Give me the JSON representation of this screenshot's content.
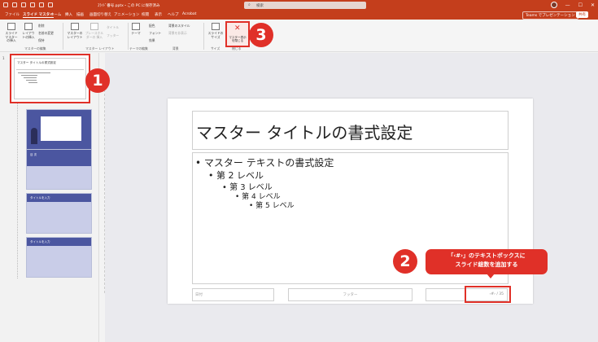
{
  "titlebar": {
    "file_name": "ｽﾗｲﾄﾞ番号.pptx・この PC に保存済み",
    "search_placeholder": "検索",
    "minimize": "—",
    "maximize": "☐",
    "close": "✕"
  },
  "tabs": [
    "ファイル",
    "スライド マスター",
    "ホーム",
    "挿入",
    "描画",
    "画面切り替え",
    "アニメーション",
    "校閲",
    "表示",
    "ヘルプ",
    "Acrobat"
  ],
  "tab_teams": "Teams でプレゼンテーション",
  "tab_share": "共有",
  "ribbon": {
    "insert_master": "スライド マスターの挿入",
    "insert_layout": "レイアウトの挿入",
    "delete": "削除",
    "rename": "名前の変更",
    "preserve": "保持",
    "master_layout": "マスターの レイアウト",
    "insert_placeholder": "プレースホルダーの 挿入",
    "title_chk": "タイトル",
    "footer_chk": "フッター",
    "theme": "テーマ",
    "colors": "配色",
    "fonts": "フォント",
    "effects": "効果",
    "bg_styles": "背景のスタイル",
    "hide_bg": "背景を非表示",
    "slide_size": "スライドの サイズ",
    "close_master": "マスター表示 を閉じる",
    "group_edit_master": "マスターの編集",
    "group_master_layout": "マスター レイアウト",
    "group_theme": "テーマの編集",
    "group_bg": "背景",
    "group_size": "サイズ",
    "group_close": "閉じる"
  },
  "thumbnails": {
    "slide_no": "1",
    "master_title": "マスター タイトルの書式設定",
    "layout3_label": "目 次",
    "layout4_label": "タイトルを入力",
    "layout5_label": "タイトルを入力"
  },
  "slide": {
    "title": "マスター タイトルの書式設定",
    "level1": "• マスター テキストの書式設定",
    "level2": "• 第 2 レベル",
    "level3": "• 第 3 レベル",
    "level4": "• 第 4 レベル",
    "level5": "• 第 5 レベル",
    "date": "日付",
    "footer": "フッター",
    "number": "‹#› / 35"
  },
  "annotations": {
    "badge1": "1",
    "badge2": "2",
    "badge3": "3",
    "callout_line1": "「‹#›」のテキストボックスに",
    "callout_line2": "スライド総数を追加する"
  },
  "colors": {
    "accent": "#c43e1c",
    "highlight": "#e03028",
    "layout_blue": "#4b56a0"
  }
}
